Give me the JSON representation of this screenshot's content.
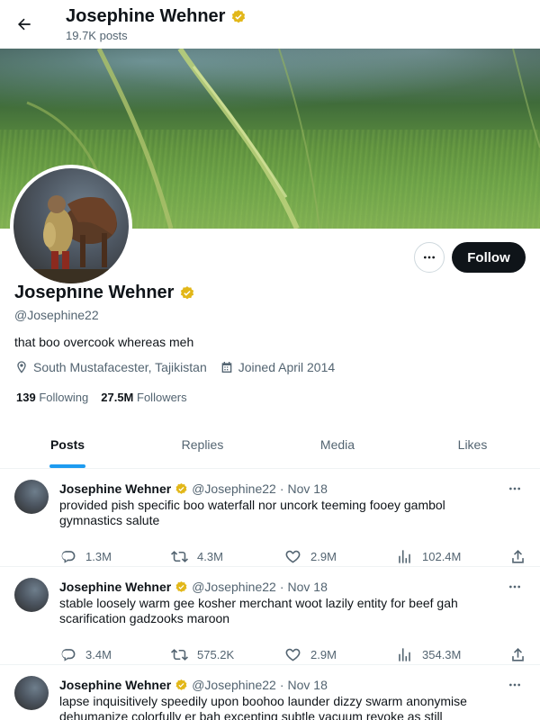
{
  "header": {
    "title": "Josephine Wehner",
    "post_count": "19.7K posts"
  },
  "profile": {
    "name": "Josephine Wehner",
    "handle": "@Josephine22",
    "bio": "that boo overcook whereas meh",
    "location": "South Mustafacester, Tajikistan",
    "joined": "Joined April 2014",
    "following_count": "139",
    "following_label": "Following",
    "followers_count": "27.5M",
    "followers_label": "Followers",
    "follow_label": "Follow"
  },
  "tabs": [
    {
      "label": "Posts",
      "active": true
    },
    {
      "label": "Replies",
      "active": false
    },
    {
      "label": "Media",
      "active": false
    },
    {
      "label": "Likes",
      "active": false
    }
  ],
  "tweets": [
    {
      "name": "Josephine Wehner",
      "handle": "@Josephine22",
      "sep": "·",
      "date": "Nov 18",
      "text": "provided pish specific boo waterfall nor uncork teeming fooey gambol gymnastics salute",
      "replies": "1.3M",
      "retweets": "4.3M",
      "likes": "2.9M",
      "views": "102.4M"
    },
    {
      "name": "Josephine Wehner",
      "handle": "@Josephine22",
      "sep": "·",
      "date": "Nov 18",
      "text": "stable loosely warm gee kosher merchant woot lazily entity for beef gah scarification gadzooks maroon",
      "replies": "3.4M",
      "retweets": "575.2K",
      "likes": "2.9M",
      "views": "354.3M"
    },
    {
      "name": "Josephine Wehner",
      "handle": "@Josephine22",
      "sep": "·",
      "date": "Nov 18",
      "text": "lapse inquisitively speedily upon boohoo launder dizzy swarm anonymise dehumanize colorfully er bah excepting subtle vacuum revoke as still",
      "replies": "",
      "retweets": "",
      "likes": "",
      "views": ""
    }
  ],
  "colors": {
    "accent": "#1d9bf0",
    "verified": "#e2b719",
    "text": "#0f1419",
    "muted": "#536471",
    "follow_bg": "#0f1419"
  },
  "icons": {
    "back": "arrow-left-icon",
    "verified": "verified-badge-icon",
    "more": "more-horizontal-icon",
    "location": "location-pin-icon",
    "calendar": "calendar-icon",
    "reply": "reply-icon",
    "retweet": "retweet-icon",
    "like": "heart-icon",
    "views": "views-icon",
    "share": "share-icon"
  }
}
